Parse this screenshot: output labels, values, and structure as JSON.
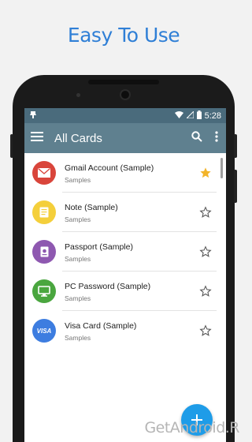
{
  "headline": "Easy To Use",
  "status_bar": {
    "time": "5:28"
  },
  "toolbar": {
    "title": "All Cards"
  },
  "cards": [
    {
      "title": "Gmail Account (Sample)",
      "subtitle": "Samples",
      "icon": "envelope-icon",
      "color": "#d9453b",
      "starred": true
    },
    {
      "title": "Note (Sample)",
      "subtitle": "Samples",
      "icon": "note-icon",
      "color": "#f4cf3b",
      "starred": false
    },
    {
      "title": "Passport (Sample)",
      "subtitle": "Samples",
      "icon": "passport-icon",
      "color": "#8e58b0",
      "starred": false
    },
    {
      "title": "PC Password (Sample)",
      "subtitle": "Samples",
      "icon": "monitor-icon",
      "color": "#4aa63f",
      "starred": false
    },
    {
      "title": "Visa Card (Sample)",
      "subtitle": "Samples",
      "icon": "visa-icon",
      "visa_text": "VISA",
      "color": "#3d7de0",
      "starred": false
    }
  ],
  "watermark": "GetAndroid.R",
  "colors": {
    "accent": "#2f7fd6",
    "toolbar": "#5f808f",
    "statusbar": "#4a6b7c",
    "star_filled": "#f2b42a",
    "fab": "#1e9ce8"
  }
}
